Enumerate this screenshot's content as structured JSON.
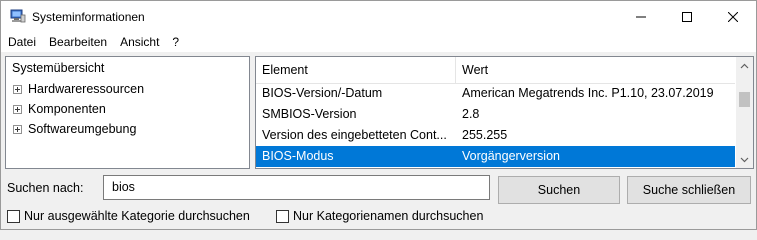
{
  "window": {
    "title": "Systeminformationen",
    "app_icon": "system-info-icon",
    "controls": [
      "minimize-icon",
      "maximize-icon",
      "close-icon"
    ]
  },
  "menu": [
    "Datei",
    "Bearbeiten",
    "Ansicht",
    "?"
  ],
  "tree": {
    "root": "Systemübersicht",
    "children": [
      "Hardwareressourcen",
      "Komponenten",
      "Softwareumgebung"
    ]
  },
  "list": {
    "columns": [
      "Element",
      "Wert"
    ],
    "rows": [
      {
        "element": "BIOS-Version/-Datum",
        "value": "American Megatrends Inc. P1.10, 23.07.2019"
      },
      {
        "element": "SMBIOS-Version",
        "value": "2.8"
      },
      {
        "element": "Version des eingebetteten Cont...",
        "value": "255.255"
      },
      {
        "element": "BIOS-Modus",
        "value": "Vorgängerversion"
      }
    ],
    "selected_row_index": 3,
    "selection_color": "#0078d7"
  },
  "search": {
    "label": "Suchen nach:",
    "value": "bios",
    "search_button": "Suchen",
    "close_button": "Suche schließen"
  },
  "options": {
    "only_selected_category": "Nur ausgewählte Kategorie durchsuchen",
    "only_category_names": "Nur Kategorienamen durchsuchen"
  }
}
